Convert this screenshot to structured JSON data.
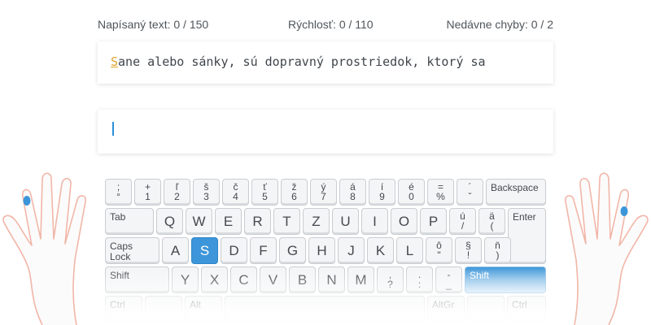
{
  "stats": {
    "typed": "Napísaný text: 0 / 150",
    "speed": "Rýchlosť: 0 / 110",
    "errors": "Nedávne chyby: 0 / 2"
  },
  "source_text": {
    "current_char": "S",
    "rest": "ane alebo sánky, sú dopravný prostriedok, ktorý sa"
  },
  "colors": {
    "accent": "#3d96d9",
    "current_char": "#e0a52b"
  },
  "keyboard": {
    "row1": [
      {
        "id": "semicolon",
        "top": ";",
        "bot": "°"
      },
      {
        "id": "1",
        "top": "+",
        "bot": "1"
      },
      {
        "id": "2",
        "top": "ľ",
        "bot": "2"
      },
      {
        "id": "3",
        "top": "š",
        "bot": "3"
      },
      {
        "id": "4",
        "top": "č",
        "bot": "4"
      },
      {
        "id": "5",
        "top": "ť",
        "bot": "5"
      },
      {
        "id": "6",
        "top": "ž",
        "bot": "6"
      },
      {
        "id": "7",
        "top": "ý",
        "bot": "7"
      },
      {
        "id": "8",
        "top": "á",
        "bot": "8"
      },
      {
        "id": "9",
        "top": "í",
        "bot": "9"
      },
      {
        "id": "0",
        "top": "é",
        "bot": "0"
      },
      {
        "id": "equals",
        "top": "=",
        "bot": "%"
      },
      {
        "id": "acute",
        "top": "´",
        "bot": "ˇ"
      }
    ],
    "backspace": "Backspace",
    "tab": "Tab",
    "row2": [
      "Q",
      "W",
      "E",
      "R",
      "T",
      "Z",
      "U",
      "I",
      "O",
      "P"
    ],
    "row2_extra": [
      {
        "id": "u-acute",
        "top": "ú",
        "bot": "/"
      },
      {
        "id": "a-umlaut",
        "top": "ä",
        "bot": "("
      }
    ],
    "enter": "Enter",
    "caps": "Caps Lock",
    "row3": [
      "A",
      "S",
      "D",
      "F",
      "G",
      "H",
      "J",
      "K",
      "L"
    ],
    "row3_extra": [
      {
        "id": "o-circumflex",
        "top": "ô",
        "bot": "\""
      },
      {
        "id": "section",
        "top": "§",
        "bot": "!"
      },
      {
        "id": "n-caron",
        "top": "ň",
        "bot": ")"
      }
    ],
    "active_key": "S",
    "shift_left": "Shift",
    "row4": [
      "Y",
      "X",
      "C",
      "V",
      "B",
      "N",
      "M"
    ],
    "row4_extra": [
      {
        "id": "comma",
        "top": ",",
        "bot": "?"
      },
      {
        "id": "period",
        "top": ".",
        "bot": ":"
      },
      {
        "id": "minus",
        "top": "-",
        "bot": "_"
      }
    ],
    "shift_right": "Shift",
    "ctrl_left": "Ctrl",
    "alt_left": "Alt",
    "alt_right": "AltGr",
    "ctrl_right": "Ctrl"
  }
}
